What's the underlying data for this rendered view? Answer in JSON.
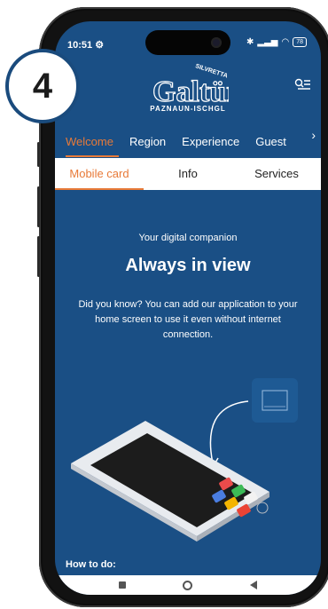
{
  "status_bar": {
    "time": "10:51",
    "icons": [
      "settings-gear",
      "bluetooth",
      "signal",
      "wifi"
    ],
    "battery": "78"
  },
  "brand": {
    "name": "Galtür",
    "arc_text": "SILVRETTA",
    "subtitle": "PAZNAUN-ISCHGL"
  },
  "main_nav": {
    "items": [
      "Welcome",
      "Region",
      "Experience",
      "Guest"
    ],
    "active_index": 0
  },
  "sub_nav": {
    "items": [
      "Mobile card",
      "Info",
      "Services"
    ],
    "active_index": 0
  },
  "content": {
    "kicker": "Your digital companion",
    "headline": "Always in view",
    "body": "Did you know? You can add our application to your home screen to use it even without internet connection."
  },
  "howto": "How to do:",
  "step_badge": "4",
  "colors": {
    "screen_bg": "#1a4f85",
    "accent": "#e87a38",
    "badge_border": "#1a4b7d"
  }
}
